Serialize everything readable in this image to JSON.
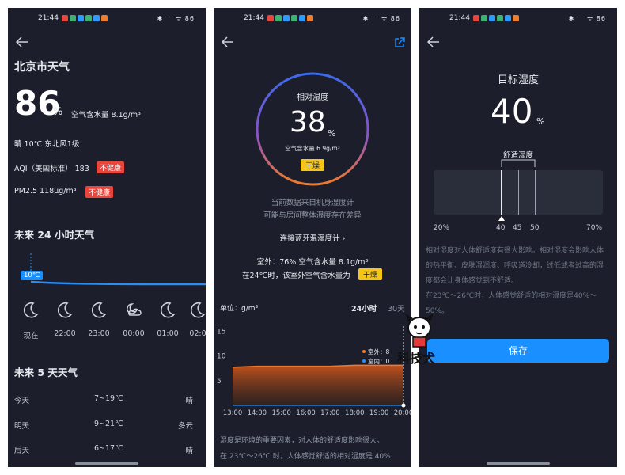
{
  "status": {
    "time": "21:44",
    "sys": "✱ ⌔ ᯤ 86",
    "notif_colors": [
      "#e8453c",
      "#3cb371",
      "#2e9bff",
      "#3cb371",
      "#2e9bff",
      "#f07d2b"
    ]
  },
  "p1": {
    "title": "北京市天气",
    "humidity_value": "86",
    "humidity_unit": "%",
    "water_content": "空气含水量  8.1g/m³",
    "weather_line": "晴     10℃    东北风1级",
    "aqi_label": "AQI（美国标准）  183",
    "aqi_badge": "不健康",
    "pm_label": "PM2.5   118μg/m³",
    "pm_badge": "不健康",
    "hourly_title": "未来 24 小时天气",
    "temp_tag": "10℃",
    "hours": [
      "现在",
      "22:00",
      "23:00",
      "00:00",
      "01:00",
      "02:0"
    ],
    "daily_title": "未来 5 天天气",
    "days": [
      {
        "day": "今天",
        "range": "7~19℃",
        "cond": "晴"
      },
      {
        "day": "明天",
        "range": "9~21℃",
        "cond": "多云"
      },
      {
        "day": "后天",
        "range": "6~17℃",
        "cond": "晴"
      }
    ]
  },
  "p2": {
    "ring_title": "相对湿度",
    "ring_value": "38",
    "ring_unit": "%",
    "ring_water": "空气含水量 6.9g/m³",
    "ring_badge": "干燥",
    "note1": "当前数据来自机身湿度计",
    "note2": "可能与房间整体湿度存在差异",
    "connect": "连接蓝牙温湿度计",
    "outdoor": "室外：76%  空气含水量  8.1g/m³",
    "indoor_prefix": "在24℃时，该室外空气含水量为",
    "indoor_badge": "干燥",
    "unit_label": "单位：g/m³",
    "tab_24h": "24小时",
    "tab_30": "30天",
    "legend_out": "室外：8",
    "legend_in": "室内：0",
    "desc1": "湿度是环境的重要因素，对人体的舒适度影响很大。",
    "desc2": "在 23℃～26℃ 时，人体感觉舒适的相对湿度是 40%"
  },
  "p3": {
    "title": "目标湿度",
    "value": "40",
    "unit": "%",
    "comfort": "舒适湿度",
    "scale": [
      "20%",
      "40",
      "45",
      "50",
      "70%"
    ],
    "desc": "相对湿度对人体舒适度有很大影响。相对湿度会影响人体的热平衡、皮肤湿润度、呼吸道冷却，过低或者过高的湿度都会让身体感觉到不舒适。",
    "desc2": "在23℃～26℃时，人体感觉舒适的相对湿度是40%～50%。",
    "save": "保存",
    "watermark": "科技犬"
  },
  "chart_data": {
    "type": "area",
    "title": "",
    "xlabel": "",
    "ylabel": "单位：g/m³",
    "categories": [
      "13:00",
      "14:00",
      "15:00",
      "16:00",
      "17:00",
      "18:00",
      "19:00",
      "20:00"
    ],
    "ylim": [
      0,
      16
    ],
    "yticks": [
      5,
      10,
      15
    ],
    "series": [
      {
        "name": "室外",
        "values": [
          7.7,
          7.9,
          7.9,
          7.9,
          7.9,
          8.1,
          8.1,
          8.1
        ]
      },
      {
        "name": "室内",
        "values": [
          0,
          0,
          0,
          0,
          0,
          0,
          0,
          0
        ]
      }
    ],
    "grid": false,
    "legend": "right"
  }
}
